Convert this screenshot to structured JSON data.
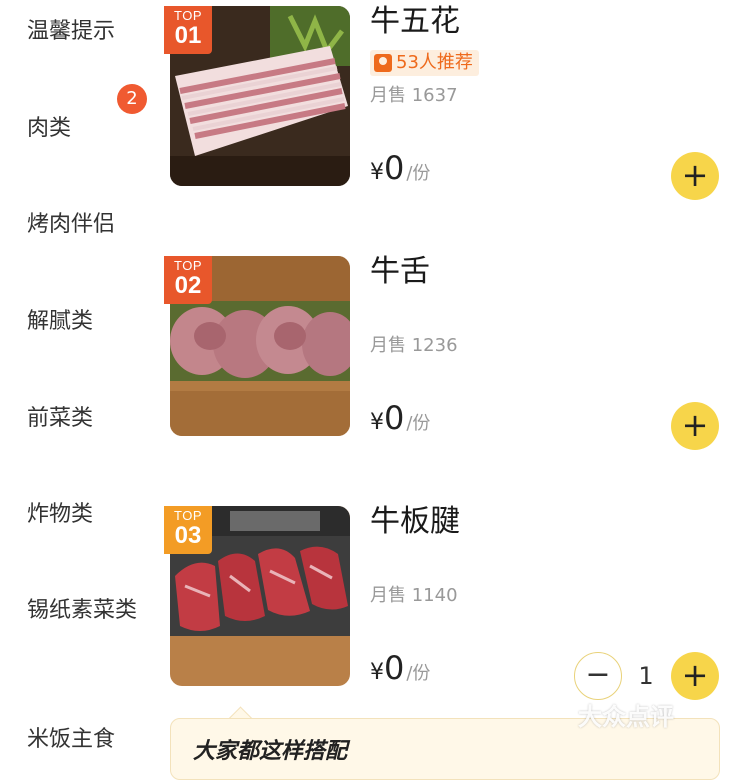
{
  "sidebar": {
    "categories": [
      {
        "label": "温馨提示"
      },
      {
        "label": "肉类",
        "badge": "2"
      },
      {
        "label": "烤肉伴侣"
      },
      {
        "label": "解腻类"
      },
      {
        "label": "前菜类"
      },
      {
        "label": "炸物类"
      },
      {
        "label": "锡纸素菜类"
      },
      {
        "label": "米饭主食"
      }
    ]
  },
  "items": [
    {
      "name": "牛五花",
      "rank_top": "TOP",
      "rank_num": "01",
      "recommend": "53人推荐",
      "sales": "月售 1637",
      "currency": "¥",
      "price": "0",
      "unit": "/份"
    },
    {
      "name": "牛舌",
      "rank_top": "TOP",
      "rank_num": "02",
      "sales": "月售 1236",
      "currency": "¥",
      "price": "0",
      "unit": "/份"
    },
    {
      "name": "牛板腱",
      "rank_top": "TOP",
      "rank_num": "03",
      "sales": "月售 1140",
      "currency": "¥",
      "price": "0",
      "unit": "/份",
      "quantity": "1"
    }
  ],
  "buttons": {
    "add": "+",
    "minus": "−"
  },
  "combo": {
    "text": "大家都这样搭配"
  },
  "watermark": "大众点评",
  "colors": {
    "accent": "#f7d54a",
    "badge": "#f05a31",
    "recommend": "#ee6a1c",
    "top1": "#e8572b",
    "top3": "#f39c25"
  }
}
